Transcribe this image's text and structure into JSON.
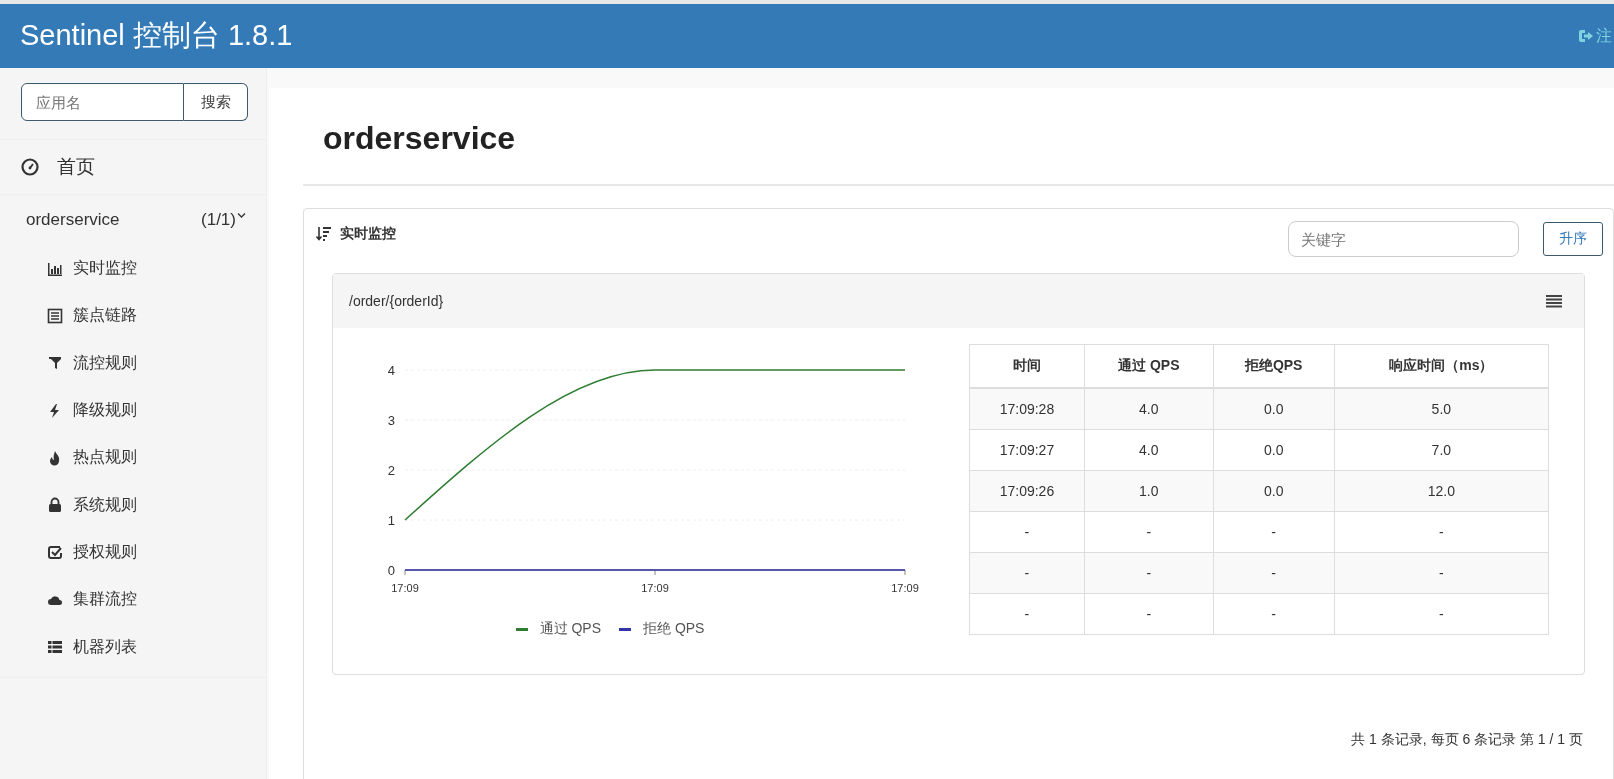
{
  "header": {
    "title": "Sentinel 控制台 1.8.1",
    "logout": "注"
  },
  "sidebar": {
    "search": {
      "placeholder": "应用名",
      "button": "搜索"
    },
    "home": "首页",
    "app": {
      "name": "orderservice",
      "count": "(1/1)",
      "expanded": true,
      "items": [
        {
          "label": "实时监控"
        },
        {
          "label": "簇点链路"
        },
        {
          "label": "流控规则"
        },
        {
          "label": "降级规则"
        },
        {
          "label": "热点规则"
        },
        {
          "label": "系统规则"
        },
        {
          "label": "授权规则"
        },
        {
          "label": "集群流控"
        },
        {
          "label": "机器列表"
        }
      ]
    }
  },
  "page": {
    "title": "orderservice"
  },
  "monitor": {
    "title": "实时监控",
    "keyword": {
      "placeholder": "关键字"
    },
    "sort_button": "升序",
    "resource": {
      "name": "/order/{orderId}",
      "chart_data": {
        "type": "line",
        "categories": [
          "17:09",
          "17:09",
          "17:09"
        ],
        "series": [
          {
            "name": "通过 QPS",
            "color": "#2e7d32",
            "values": [
              1,
              4,
              4
            ]
          },
          {
            "name": "拒绝 QPS",
            "color": "#3333aa",
            "values": [
              0,
              0,
              0
            ]
          }
        ],
        "ylim": [
          0,
          4
        ],
        "yticks": [
          0,
          1,
          2,
          3,
          4
        ],
        "grid": true,
        "legend": "bottom"
      },
      "table": {
        "columns": [
          "时间",
          "通过 QPS",
          "拒绝QPS",
          "响应时间（ms）"
        ],
        "rows": [
          [
            "17:09:28",
            "4.0",
            "0.0",
            "5.0"
          ],
          [
            "17:09:27",
            "4.0",
            "0.0",
            "7.0"
          ],
          [
            "17:09:26",
            "1.0",
            "0.0",
            "12.0"
          ],
          [
            "-",
            "-",
            "-",
            "-"
          ],
          [
            "-",
            "-",
            "-",
            "-"
          ],
          [
            "-",
            "-",
            "-",
            "-"
          ]
        ]
      }
    },
    "pagination": "共 1 条记录, 每页 6 条记录 第 1 / 1 页"
  }
}
